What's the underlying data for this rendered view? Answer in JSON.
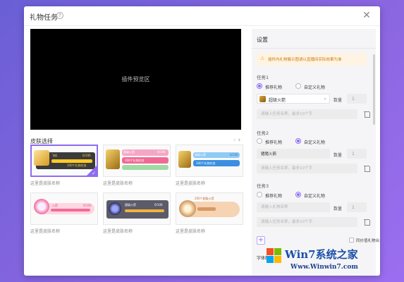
{
  "window": {
    "title": "礼物任务"
  },
  "preview": {
    "label": "插件预览区"
  },
  "skins": {
    "heading": "皮肤选择",
    "nav_prev": "‹",
    "nav_next": "›",
    "items": [
      {
        "name": "这里是皮肤名称",
        "selected": true,
        "gift_text": "飞机",
        "count_text": "0/100",
        "bar_text": "100个礼物任务"
      },
      {
        "name": "这里是皮肤名称",
        "selected": false,
        "gift_text": "超级火箭",
        "count_text": "0/100",
        "bar_text": "100个礼物任务"
      },
      {
        "name": "这里是皮肤名称",
        "selected": false,
        "gift_text": "超级火箭",
        "count_text": "0/100",
        "bar_text": "100个礼物任务"
      },
      {
        "name": "这里是皮肤名称",
        "selected": false,
        "gift_text": "火箭",
        "count_text": "0/100",
        "bar_text": ""
      },
      {
        "name": "这里是皮肤名称",
        "selected": false,
        "gift_text": "超级火箭",
        "count_text": "0/100",
        "bar_text": ""
      },
      {
        "name": "这里是皮肤名称",
        "selected": false,
        "gift_text": "200个超级火箭",
        "count_text": "",
        "bar_text": ""
      }
    ]
  },
  "settings": {
    "title": "设置",
    "notice": "插件内礼物展示图请以直播间实际效果为准",
    "tasks": [
      {
        "label": "任务1",
        "option_recommended": "推荐礼物",
        "option_custom": "自定义礼物",
        "mode": "recommended",
        "gift_value": "超级火箭",
        "gift_placeholder": "",
        "qty_label": "数量",
        "qty_value": "1",
        "name_placeholder": "请输入任务名称，最多10个字"
      },
      {
        "label": "任务2",
        "option_recommended": "推荐礼物",
        "option_custom": "自定义礼物",
        "mode": "custom",
        "gift_value": "猪猪火箭",
        "gift_placeholder": "",
        "qty_label": "数量",
        "qty_value": "1",
        "name_placeholder": "请输入任务名称，最多10个字"
      },
      {
        "label": "任务3",
        "option_recommended": "推荐礼物",
        "option_custom": "自定义礼物",
        "mode": "custom",
        "gift_value": "",
        "gift_placeholder": "请输入礼物名称",
        "qty_label": "数量",
        "qty_value": "1",
        "name_placeholder": "请输入任务名称，最多10个字"
      }
    ],
    "add_label": "+",
    "merge_label": "同价值礼物合并",
    "font_label": "字体颜色"
  },
  "watermark": {
    "brand": "Win7系统之家",
    "url": "Www.Winwin7.com"
  },
  "colors": {
    "accent": "#8e6cf0",
    "panel_bg": "#f5f5f7",
    "notice_bg": "#fff4e3",
    "notice_text": "#c87c10"
  }
}
